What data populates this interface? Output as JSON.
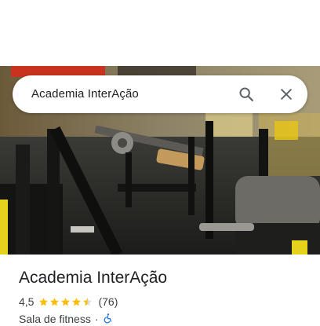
{
  "search": {
    "query": "Academia InterAção"
  },
  "place": {
    "name": "Academia InterAção",
    "rating": "4,5",
    "rating_value": 4.5,
    "max_rating": 5,
    "review_count": "(76)",
    "category": "Sala de fitness",
    "separator": "·",
    "accessibility_icon": "wheelchair-icon"
  },
  "colors": {
    "star": "#fbbc04",
    "star_empty": "#dadce0",
    "accent_blue": "#1a73e8",
    "text_primary": "#202124",
    "text_secondary": "#3c4043"
  }
}
